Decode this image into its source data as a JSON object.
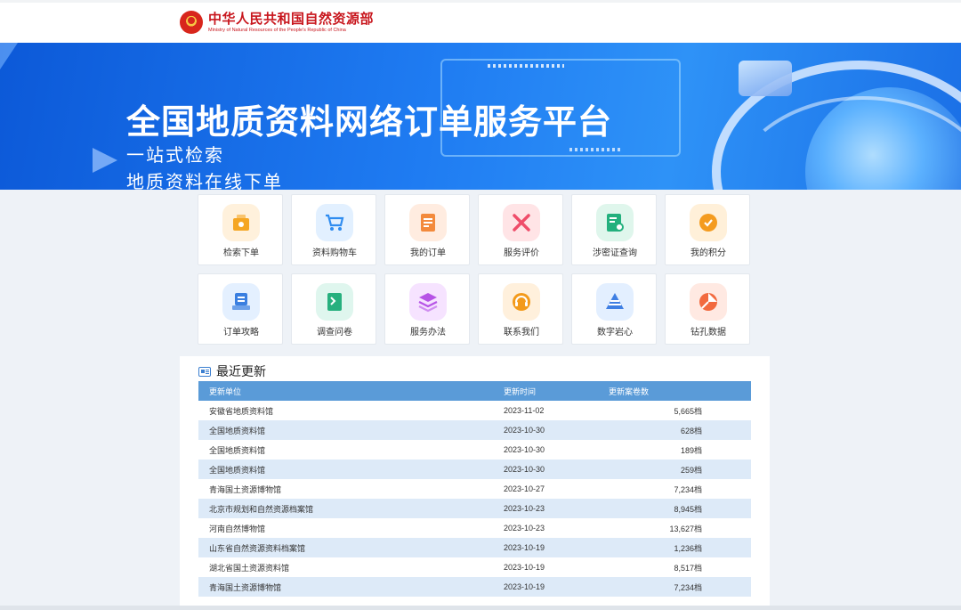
{
  "header": {
    "org_name_cn": "中华人民共和国自然资源部",
    "org_name_en": "Ministry of Natural Resources of the People's Republic of China",
    "brand_color": "#c8161d"
  },
  "banner": {
    "title": "全国地质资料网络订单服务平台",
    "subtitle1": "一站式检索",
    "subtitle2": "地质资料在线下单"
  },
  "tiles": [
    {
      "label": "检索下单",
      "icon": "search-order-icon",
      "bg": "#fff1dc",
      "color": "#f5a623"
    },
    {
      "label": "资料购物车",
      "icon": "cart-icon",
      "bg": "#e2f0ff",
      "color": "#2f8cf0"
    },
    {
      "label": "我的订单",
      "icon": "order-list-icon",
      "bg": "#ffece0",
      "color": "#f38a3c"
    },
    {
      "label": "服务评价",
      "icon": "evaluation-icon",
      "bg": "#ffe4e6",
      "color": "#ef4d6a"
    },
    {
      "label": "涉密证查询",
      "icon": "certificate-query-icon",
      "bg": "#dff6ec",
      "color": "#23b07d"
    },
    {
      "label": "我的积分",
      "icon": "points-icon",
      "bg": "#fff0d9",
      "color": "#f49b1f"
    },
    {
      "label": "订单攻略",
      "icon": "order-guide-icon",
      "bg": "#e4f0ff",
      "color": "#3a7fe0"
    },
    {
      "label": "调查问卷",
      "icon": "questionnaire-icon",
      "bg": "#dff6ee",
      "color": "#27b07e"
    },
    {
      "label": "服务办法",
      "icon": "service-rules-icon",
      "bg": "#f6e3ff",
      "color": "#b653e6"
    },
    {
      "label": "联系我们",
      "icon": "contact-icon",
      "bg": "#fff0dc",
      "color": "#f39a1b"
    },
    {
      "label": "数字岩心",
      "icon": "digital-core-icon",
      "bg": "#e3efff",
      "color": "#3f7fe3"
    },
    {
      "label": "钻孔数据",
      "icon": "drill-data-icon",
      "bg": "#ffe9e2",
      "color": "#f26a3f"
    }
  ],
  "updates": {
    "title": "最近更新",
    "columns": [
      "更新单位",
      "更新时间",
      "更新案卷数"
    ],
    "rows": [
      {
        "unit": "安徽省地质资料馆",
        "date": "2023-11-02",
        "count": "5,665档"
      },
      {
        "unit": "全国地质资料馆",
        "date": "2023-10-30",
        "count": "628档"
      },
      {
        "unit": "全国地质资料馆",
        "date": "2023-10-30",
        "count": "189档"
      },
      {
        "unit": "全国地质资料馆",
        "date": "2023-10-30",
        "count": "259档"
      },
      {
        "unit": "青海国土资源博物馆",
        "date": "2023-10-27",
        "count": "7,234档"
      },
      {
        "unit": "北京市规划和自然资源档案馆",
        "date": "2023-10-23",
        "count": "8,945档"
      },
      {
        "unit": "河南自然博物馆",
        "date": "2023-10-23",
        "count": "13,627档"
      },
      {
        "unit": "山东省自然资源资料档案馆",
        "date": "2023-10-19",
        "count": "1,236档"
      },
      {
        "unit": "湖北省国土资源资料馆",
        "date": "2023-10-19",
        "count": "8,517档"
      },
      {
        "unit": "青海国土资源博物馆",
        "date": "2023-10-19",
        "count": "7,234档"
      }
    ]
  }
}
